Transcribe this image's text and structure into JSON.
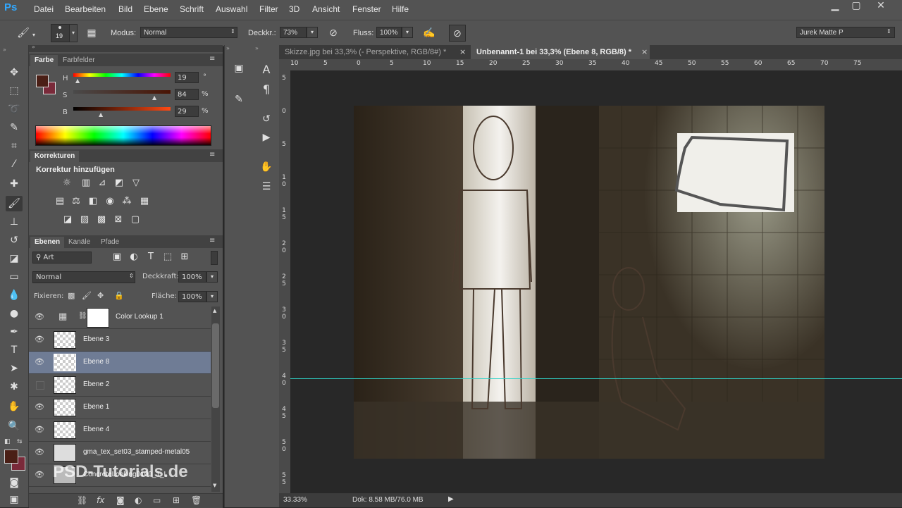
{
  "app": {
    "logo": "Ps"
  },
  "menu": [
    "Datei",
    "Bearbeiten",
    "Bild",
    "Ebene",
    "Schrift",
    "Auswahl",
    "Filter",
    "3D",
    "Ansicht",
    "Fenster",
    "Hilfe"
  ],
  "options": {
    "brush_size": "19",
    "mode_label": "Modus:",
    "mode_value": "Normal",
    "opacity_label": "Deckkr.:",
    "opacity_value": "73%",
    "flow_label": "Fluss:",
    "flow_value": "100%",
    "workspace": "Jurek Matte P"
  },
  "color_panel": {
    "tabs": [
      "Farbe",
      "Farbfelder"
    ],
    "h_label": "H",
    "h_value": "19",
    "h_unit": "°",
    "s_label": "S",
    "s_value": "84",
    "s_unit": "%",
    "b_label": "B",
    "b_value": "29",
    "b_unit": "%",
    "foreground": "#4a1f16",
    "background": "#7a2a3a"
  },
  "adjustments": {
    "tab": "Korrekturen",
    "title": "Korrektur hinzufügen"
  },
  "layers_panel": {
    "tabs": [
      "Ebenen",
      "Kanäle",
      "Pfade"
    ],
    "filter_kind": "Art",
    "blend_mode": "Normal",
    "opacity_label": "Deckkraft:",
    "opacity_value": "100%",
    "lock_label": "Fixieren:",
    "fill_label": "Fläche:",
    "fill_value": "100%",
    "layers": [
      {
        "name": "Color Lookup 1",
        "visible": true,
        "selected": false
      },
      {
        "name": "Ebene 3",
        "visible": true,
        "selected": false
      },
      {
        "name": "Ebene 8",
        "visible": true,
        "selected": true
      },
      {
        "name": "Ebene 2",
        "visible": false,
        "selected": false
      },
      {
        "name": "Ebene 1",
        "visible": true,
        "selected": false
      },
      {
        "name": "Ebene 4",
        "visible": true,
        "selected": false
      },
      {
        "name": "gma_tex_set03_stamped-metal05",
        "visible": true,
        "selected": false
      },
      {
        "name": "ConcreteLooking0100_1_L",
        "visible": true,
        "selected": false
      }
    ]
  },
  "documents": {
    "tabs": [
      "Skizze.jpg bei 33,3% (- Perspektive, RGB/8#) *",
      "Unbenannt-1 bei 33,3% (Ebene 8, RGB/8) *"
    ],
    "active": 1
  },
  "ruler": {
    "h": [
      "10",
      "5",
      "0",
      "5",
      "10",
      "15",
      "20",
      "25",
      "30",
      "35",
      "40",
      "45",
      "50",
      "55",
      "60",
      "65",
      "70",
      "75"
    ],
    "v": [
      "5",
      "0",
      "5",
      "1\n0",
      "1\n5",
      "2\n0",
      "2\n5",
      "3\n0",
      "3\n5",
      "4\n0",
      "4\n5",
      "5\n0",
      "5\n5"
    ]
  },
  "status": {
    "zoom": "33.33%",
    "doc": "Dok: 8.58 MB/76.0 MB"
  },
  "watermark": "PSD-Tutorials.de",
  "icons": {
    "close": "×",
    "minimize": "—",
    "maximize": "□",
    "eye": "eye-icon",
    "brush": "brush-icon"
  }
}
